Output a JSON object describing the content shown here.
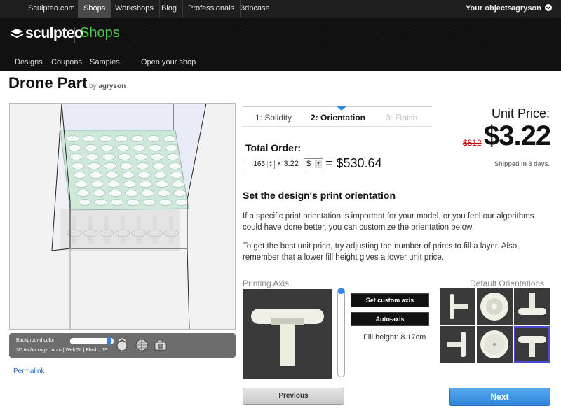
{
  "topnav": {
    "items": [
      "Sculpteo.com",
      "Shops",
      "Workshops",
      "Blog",
      "Professionals",
      "3dpcase"
    ],
    "your_objects": "Your objects",
    "user": "agryson"
  },
  "header": {
    "brand": "sculpteo",
    "section": "Shops"
  },
  "subnav": {
    "items": [
      "Designs",
      "Coupons",
      "Samples",
      "Open your shop"
    ]
  },
  "product": {
    "title": "Drone Part",
    "by_prefix": "by",
    "author": "agryson"
  },
  "viewer": {
    "background_label": "Background color:",
    "tech_label": "3D technology :",
    "tech_options": "Auto | WebGL | Flash | JS"
  },
  "permalink": "Permalink",
  "steps": {
    "s1": "1: Solidity",
    "s2": "2: Orientation",
    "s3": "3: Finish"
  },
  "order": {
    "total_label": "Total Order:",
    "quantity": "165",
    "times_price": "× 3.22",
    "currency": "$",
    "total": "= $530.64"
  },
  "price": {
    "unit_label": "Unit Price:",
    "old": "$812",
    "unit": "$3.22",
    "shipping": "Shipped in 3 days."
  },
  "orientation": {
    "heading": "Set the design's print orientation",
    "para1": "If a specific print orientation is important for your model, or you feel our algorithms could have done better, you can customize the orientation below.",
    "para2": "To get the best unit price, try adjusting the number of prints to fill a layer. Also, remember that a lower fill height gives a lower unit price.",
    "axis_label": "Printing Axis",
    "custom_axis": "Set custom axis",
    "auto_axis": "Auto-axis",
    "fill_height": "Fill height: 8.17cm",
    "defaults_label": "Default Orientations"
  },
  "nav_buttons": {
    "previous": "Previous",
    "next": "Next"
  },
  "colors": {
    "accent": "#2e86e6",
    "brand_green": "#4bc94b",
    "old_price": "#cc0000"
  }
}
